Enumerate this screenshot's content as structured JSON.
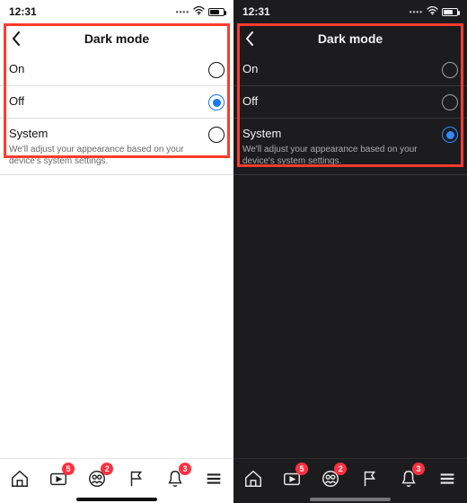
{
  "status": {
    "time": "12:31"
  },
  "header": {
    "title": "Dark mode"
  },
  "options": {
    "on": {
      "label": "On"
    },
    "off": {
      "label": "Off"
    },
    "system": {
      "label": "System",
      "sub": "We'll adjust your appearance based on your device's system settings."
    }
  },
  "light": {
    "selected": "off"
  },
  "dark": {
    "selected": "system"
  },
  "tabs": {
    "watch_badge": "5",
    "groups_badge": "2",
    "notif_badge": "3"
  },
  "colors": {
    "accent": "#1877f2",
    "highlight": "#ff3b2f",
    "badge": "#ff3040",
    "dark_bg": "#1c1c1e"
  }
}
